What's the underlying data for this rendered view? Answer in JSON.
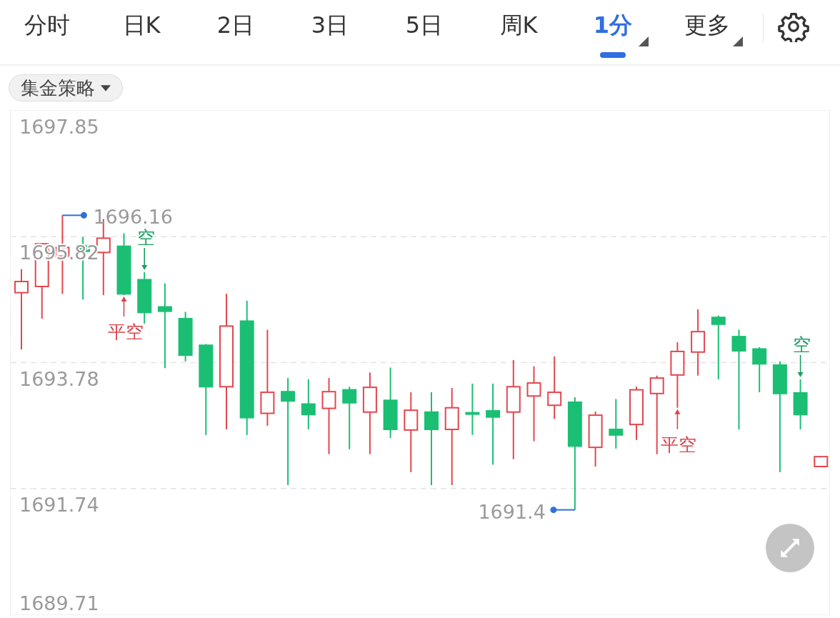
{
  "tabs": [
    {
      "label": "分时",
      "selected": false,
      "dropdown": false
    },
    {
      "label": "日K",
      "selected": false,
      "dropdown": false
    },
    {
      "label": "2日",
      "selected": false,
      "dropdown": false
    },
    {
      "label": "3日",
      "selected": false,
      "dropdown": false
    },
    {
      "label": "5日",
      "selected": false,
      "dropdown": false
    },
    {
      "label": "周K",
      "selected": false,
      "dropdown": false
    },
    {
      "label": "1分",
      "selected": true,
      "dropdown": true
    },
    {
      "label": "更多",
      "selected": false,
      "dropdown": true
    }
  ],
  "strategy_dropdown": {
    "label": "集金策略"
  },
  "chart": {
    "price_labels": [
      "1697.85",
      "1695.82",
      "1693.78",
      "1691.74",
      "1689.71"
    ],
    "markers": [
      {
        "kind": "high",
        "text": "1696.16"
      },
      {
        "kind": "short",
        "text": "空"
      },
      {
        "kind": "cover",
        "text": "平空"
      },
      {
        "kind": "low",
        "text": "1691.4"
      },
      {
        "kind": "cover",
        "text": "平空"
      },
      {
        "kind": "short",
        "text": "空"
      }
    ]
  }
}
